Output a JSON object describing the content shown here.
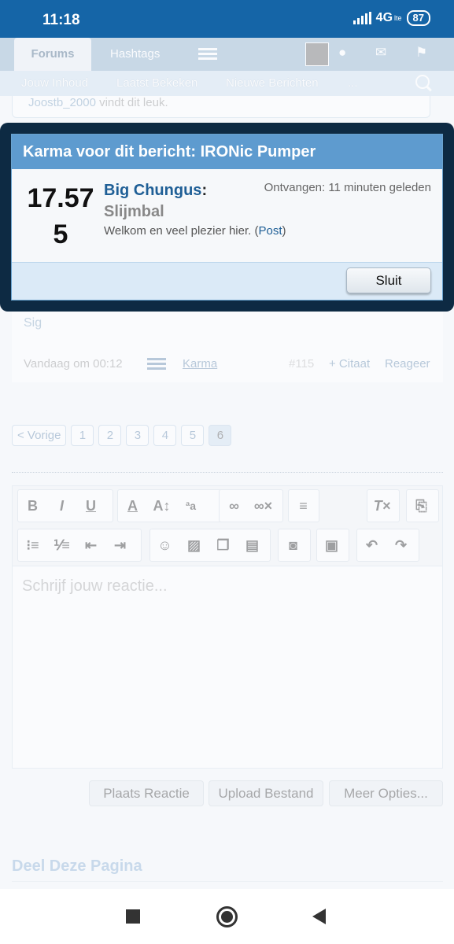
{
  "status_bar": {
    "time": "11:18",
    "network": "4G",
    "network_sub": "lte",
    "battery": "87"
  },
  "header": {
    "tabs": [
      {
        "label": "Forums"
      },
      {
        "label": "Hashtags"
      }
    ]
  },
  "subnav": {
    "items": [
      "Jouw Inhoud",
      "Laatst Bekeken",
      "Nieuwe Berichten",
      "..."
    ]
  },
  "liked": {
    "user": "Joostb_2000",
    "text": " vindt dit leuk."
  },
  "post_footer": {
    "signature": "Sig",
    "date": "Vandaag om 00:12",
    "karma_link": "Karma",
    "post_number": "#115",
    "quote": "+ Citaat",
    "reply": "Reageer"
  },
  "pagination": {
    "prev": "< Vorige",
    "pages": [
      "1",
      "2",
      "3",
      "4",
      "5",
      "6"
    ],
    "current": "6"
  },
  "editor": {
    "placeholder": "Schrijf jouw reactie...",
    "icons": [
      "bold-icon",
      "italic-icon",
      "underline-icon",
      "font-color-icon",
      "font-size-icon",
      "font-family-icon",
      "link-icon",
      "unlink-icon",
      "align-icon",
      "remove-format-icon",
      "help-icon",
      "bullet-list-icon",
      "numbered-list-icon",
      "outdent-icon",
      "indent-icon",
      "smiley-icon",
      "image-icon",
      "media-icon",
      "template-icon",
      "camera-icon",
      "save-icon",
      "undo-icon",
      "redo-icon"
    ]
  },
  "actions": {
    "submit": "Plaats Reactie",
    "upload": "Upload Bestand",
    "more": "Meer Opties..."
  },
  "share": {
    "title": "Deel Deze Pagina"
  },
  "modal": {
    "title": "Karma voor dit bericht: IRONic Pumper",
    "value": "17.575",
    "giver": "Big Chungus",
    "colon": ":",
    "received": "Ontvangen: 11 minuten geleden",
    "rank": "Slijmbal",
    "message": "Welkom en veel plezier hier. (",
    "post_link": "Post",
    "message_end": ")",
    "close": "Sluit"
  },
  "colors": {
    "status_bar": "#1565a7",
    "modal_header": "#5e9bcf",
    "link": "#1f5f96",
    "modal_frame": "#0d2a43"
  }
}
